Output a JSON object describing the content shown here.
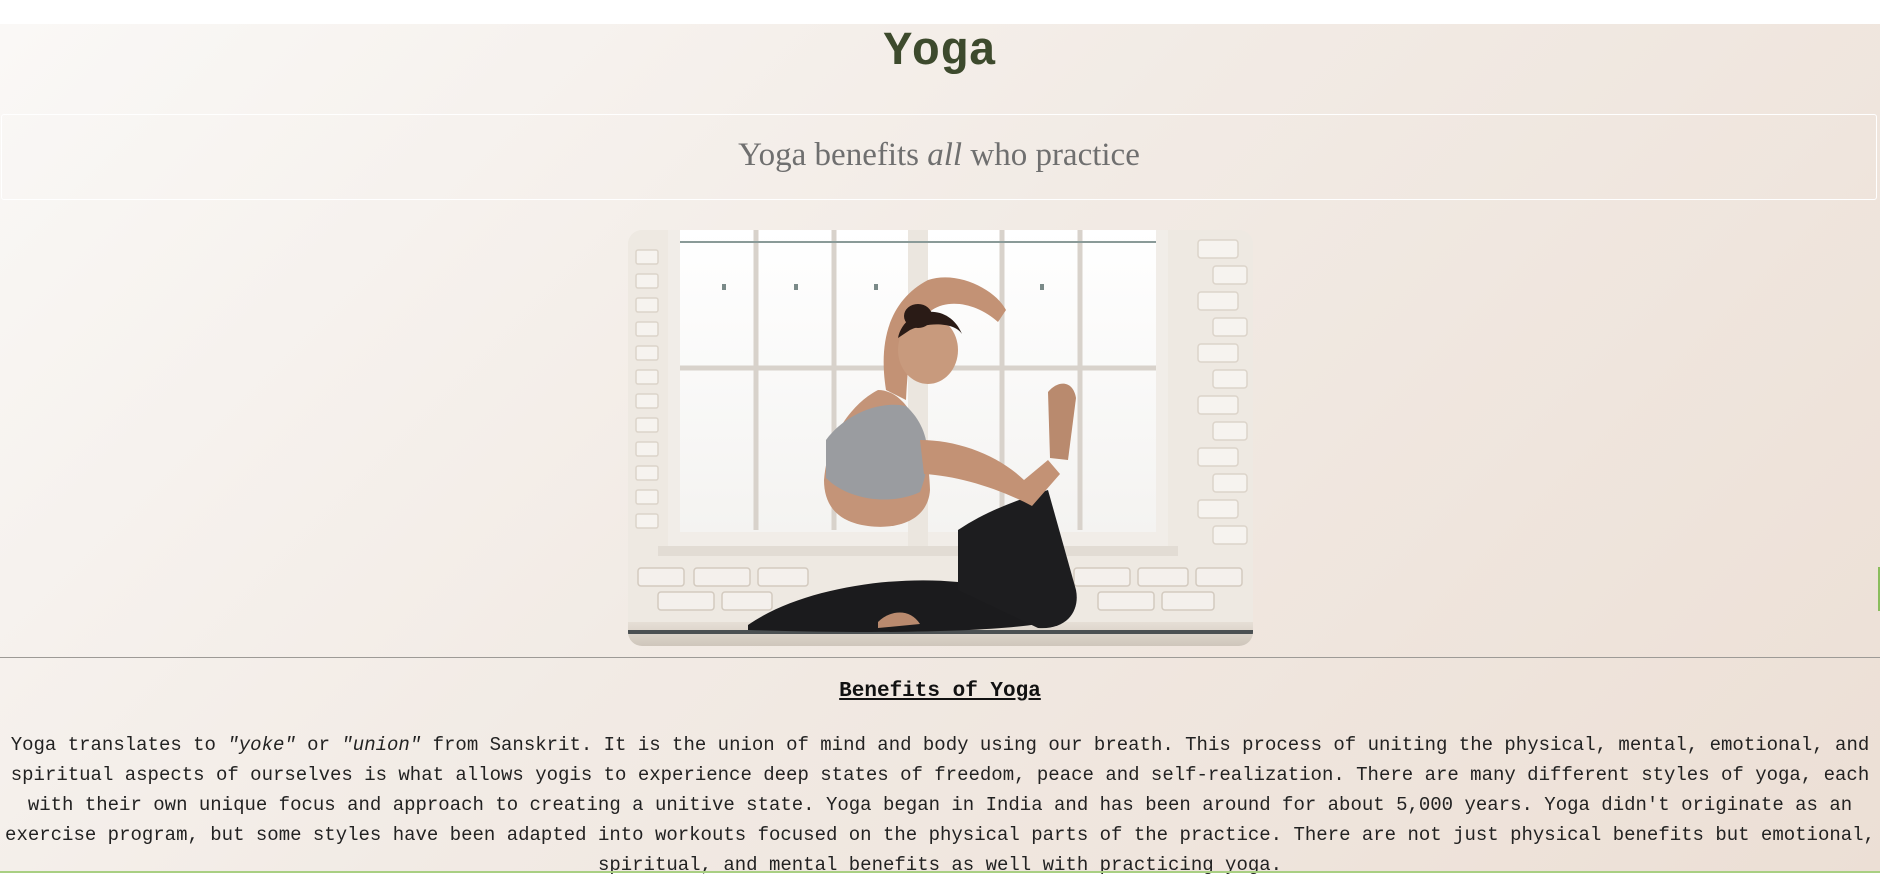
{
  "header": {
    "title": "Yoga"
  },
  "tagline": {
    "before": "Yoga benefits ",
    "emphasis": "all",
    "after": " who practice"
  },
  "hero_image": {
    "alt": "Woman in a yoga pose in front of a window"
  },
  "benefits": {
    "heading": "Benefits of Yoga",
    "p1": "Yoga translates to ",
    "yoke": "\"yoke\"",
    "or": " or ",
    "union": "\"union\"",
    "p2": " from Sanskrit. It is the union of mind and body using our breath. This process of uniting the physical, mental, emotional, and spiritual aspects of ourselves is what allows yogis to experience deep states of freedom, peace and self-realization. There are many different styles of yoga, each with their own unique focus and approach to creating a unitive state. Yoga began in India and has been around for about 5,000 years. Yoga didn't originate as an exercise program, but some styles have been adapted into workouts focused on the physical parts of the practice. There are not just physical benefits but emotional, spiritual, and mental benefits as well with practicing yoga."
  },
  "colors": {
    "title": "#3d4a2d",
    "subtitle": "#6f6f6f",
    "accent": "#8bbd5d"
  }
}
